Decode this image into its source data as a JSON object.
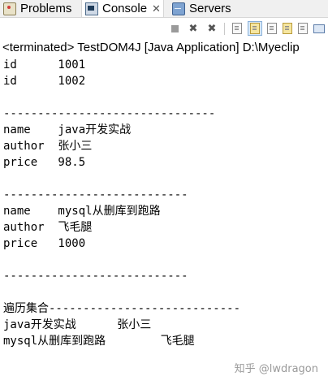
{
  "tabs": [
    {
      "label": "Problems",
      "icon": "problems-icon"
    },
    {
      "label": "Console",
      "icon": "console-icon",
      "close": "✕"
    },
    {
      "label": "Servers",
      "icon": "servers-icon"
    }
  ],
  "toolbar": {
    "buttons": [
      "terminate-icon",
      "remove-launch-icon",
      "remove-all-terminated-icon",
      "clear-console-icon",
      "scroll-lock-icon",
      "word-wrap-icon",
      "show-on-stdout-icon",
      "show-on-stderr-icon",
      "pin-console-icon",
      "display-console-icon",
      "open-console-icon"
    ]
  },
  "status": {
    "terminated": "<terminated> TestDOM4J [Java Application] D:\\Myeclip"
  },
  "console": {
    "lines": [
      "id      1001",
      "id      1002",
      "",
      "-------------------------------",
      "name    java开发实战",
      "author  张小三",
      "price   98.5",
      "",
      "---------------------------",
      "name    mysql从删库到跑路",
      "author  飞毛腿",
      "price   1000",
      "",
      "---------------------------",
      "",
      "遍历集合----------------------------",
      "java开发实战      张小三",
      "mysql从删库到跑路        飞毛腿"
    ]
  },
  "watermark": "知乎 @lwdragon"
}
